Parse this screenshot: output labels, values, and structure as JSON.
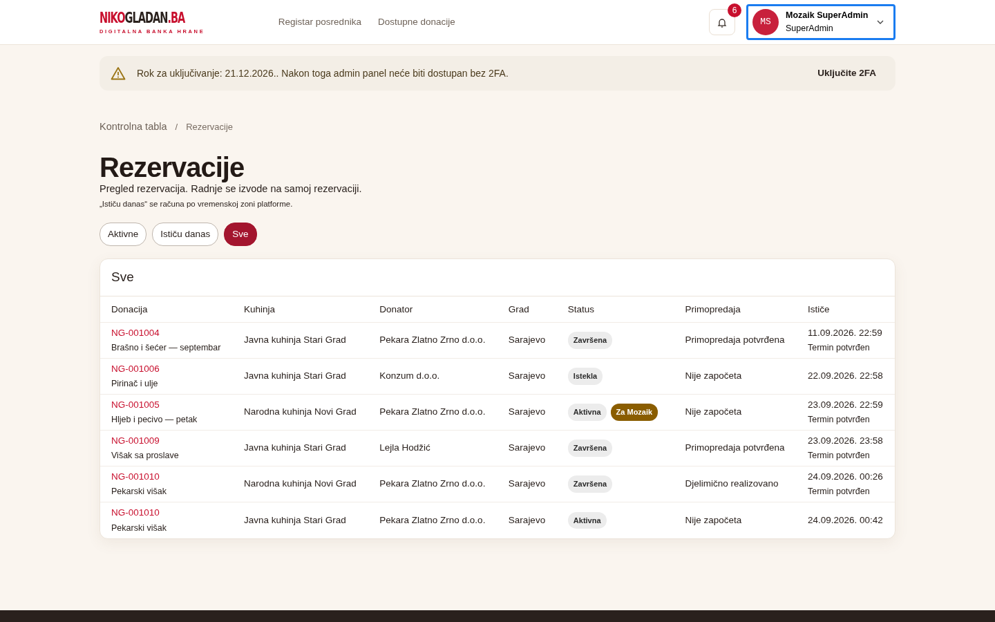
{
  "navbar": {
    "logo": {
      "parts": [
        {
          "text": "NIKO",
          "accent": true
        },
        {
          "text": "GLADAN",
          "accent": false
        },
        {
          "text": ".BA",
          "accent": true
        }
      ],
      "tagline": "DIGITALNA BANKA HRANE"
    },
    "links": [
      "Registar posrednika",
      "Dostupne donacije"
    ],
    "notifications": {
      "count": "6"
    },
    "user": {
      "initials": "MS",
      "name": "Mozaik SuperAdmin",
      "role": "SuperAdmin",
      "focused": true
    }
  },
  "alert": {
    "text": "Rok za uključivanje: 21.12.2026.. Nakon toga admin panel neće biti dostupan bez 2FA.",
    "action": "Uključite 2FA"
  },
  "breadcrumb": {
    "items": [
      "Kontrolna tabla",
      "Rezervacije"
    ],
    "separator": "/"
  },
  "page": {
    "title": "Rezervacije",
    "subtitle": "Pregled rezervacija. Radnje se izvode na samoj rezervaciji.",
    "note": "„Ističu danas“ se računa po vremenskoj zoni platforme."
  },
  "filters": [
    {
      "label": "Aktivne",
      "selected": false
    },
    {
      "label": "Ističu danas",
      "selected": false
    },
    {
      "label": "Sve",
      "selected": true
    }
  ],
  "table": {
    "title": "Sve",
    "columns": [
      "Donacija",
      "Kuhinja",
      "Donator",
      "Grad",
      "Status",
      "Primopredaja",
      "Ističe"
    ],
    "rows": [
      {
        "code": "NG-001004",
        "name": "Brašno i šećer — septembar",
        "kitchen": "Javna kuhinja Stari Grad",
        "donor": "Pekara Zlatno Zrno d.o.o.",
        "city": "Sarajevo",
        "badges": [
          {
            "text": "Završena",
            "kind": "neutral"
          }
        ],
        "handover": "Primopredaja potvrđena",
        "expires": "11.09.2026. 22:59",
        "expires_note": "Termin potvrđen"
      },
      {
        "code": "NG-001006",
        "name": "Pirinač i ulje",
        "kitchen": "Javna kuhinja Stari Grad",
        "donor": "Konzum d.o.o.",
        "city": "Sarajevo",
        "badges": [
          {
            "text": "Istekla",
            "kind": "neutral"
          }
        ],
        "handover": "Nije započeta",
        "expires": "22.09.2026. 22:58"
      },
      {
        "code": "NG-001005",
        "name": "Hljeb i pecivo — petak",
        "kitchen": "Narodna kuhinja Novi Grad",
        "donor": "Pekara Zlatno Zrno d.o.o.",
        "city": "Sarajevo",
        "badges": [
          {
            "text": "Aktivna",
            "kind": "neutral"
          },
          {
            "text": "Za Mozaik",
            "kind": "accent"
          }
        ],
        "handover": "Nije započeta",
        "expires": "23.09.2026. 22:59",
        "expires_note": "Termin potvrđen"
      },
      {
        "code": "NG-001009",
        "name": "Višak sa proslave",
        "kitchen": "Javna kuhinja Stari Grad",
        "donor": "Lejla Hodžić",
        "city": "Sarajevo",
        "badges": [
          {
            "text": "Završena",
            "kind": "neutral"
          }
        ],
        "handover": "Primopredaja potvrđena",
        "expires": "23.09.2026. 23:58",
        "expires_note": "Termin potvrđen"
      },
      {
        "code": "NG-001010",
        "name": "Pekarski višak",
        "kitchen": "Narodna kuhinja Novi Grad",
        "donor": "Pekara Zlatno Zrno d.o.o.",
        "city": "Sarajevo",
        "badges": [
          {
            "text": "Završena",
            "kind": "neutral"
          }
        ],
        "handover": "Djelimično realizovano",
        "expires": "24.09.2026. 00:26",
        "expires_note": "Termin potvrđen"
      },
      {
        "code": "NG-001010",
        "name": "Pekarski višak",
        "kitchen": "Javna kuhinja Stari Grad",
        "donor": "Pekara Zlatno Zrno d.o.o.",
        "city": "Sarajevo",
        "badges": [
          {
            "text": "Aktivna",
            "kind": "neutral"
          }
        ],
        "handover": "Nije započeta",
        "expires": "24.09.2026. 00:42"
      }
    ]
  }
}
